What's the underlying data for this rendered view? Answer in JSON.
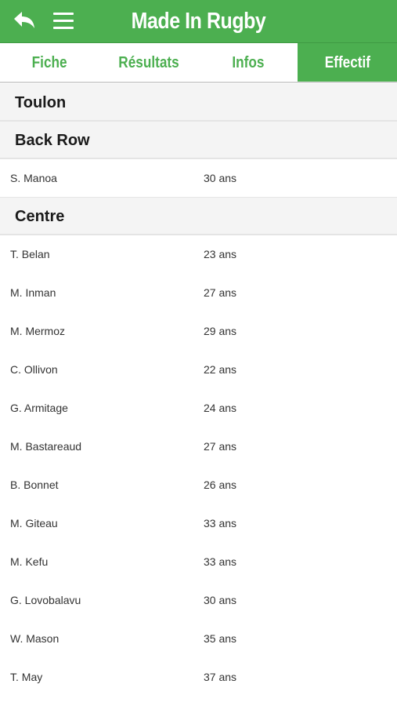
{
  "appbar": {
    "title": "Made In Rugby",
    "back_icon": "back-arrow-icon",
    "menu_icon": "hamburger-menu-icon",
    "accent_color": "#4caf50"
  },
  "tabs": [
    {
      "label": "Fiche",
      "active": false
    },
    {
      "label": "Résultats",
      "active": false
    },
    {
      "label": "Infos",
      "active": false
    },
    {
      "label": "Effectif",
      "active": true
    }
  ],
  "team": "Toulon",
  "groups": [
    {
      "position": "Back Row",
      "players": [
        {
          "name": "S. Manoa",
          "age": "30 ans"
        }
      ]
    },
    {
      "position": "Centre",
      "players": [
        {
          "name": "T. Belan",
          "age": "23 ans"
        },
        {
          "name": "M. Inman",
          "age": "27 ans"
        },
        {
          "name": "M. Mermoz",
          "age": "29 ans"
        },
        {
          "name": "C. Ollivon",
          "age": "22 ans"
        },
        {
          "name": "G. Armitage",
          "age": "24 ans"
        },
        {
          "name": "M. Bastareaud",
          "age": "27 ans"
        },
        {
          "name": "B. Bonnet",
          "age": "26 ans"
        },
        {
          "name": "M. Giteau",
          "age": "33 ans"
        },
        {
          "name": "M. Kefu",
          "age": "33 ans"
        },
        {
          "name": "G. Lovobalavu",
          "age": "30 ans"
        },
        {
          "name": "W. Mason",
          "age": "35 ans"
        },
        {
          "name": "T. May",
          "age": "37 ans"
        }
      ]
    }
  ]
}
